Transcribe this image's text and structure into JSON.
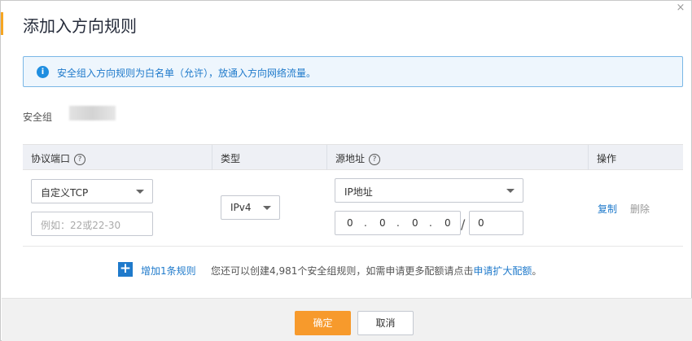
{
  "dialog": {
    "title": "添加入方向规则",
    "close_glyph": "×"
  },
  "notice": {
    "icon": "i",
    "text": "安全组入方向规则为白名单（允许），放通入方向网络流量。"
  },
  "security_group": {
    "label": "安全组"
  },
  "table": {
    "headers": {
      "protocol_port": "协议端口",
      "type": "类型",
      "source": "源地址",
      "actions": "操作"
    },
    "help_glyph": "?",
    "row": {
      "protocol": "自定义TCP",
      "port_placeholder": "例如：22或22-30",
      "ip_type": "IPv4",
      "source_type": "IP地址",
      "ip": [
        "0",
        "0",
        "0",
        "0"
      ],
      "ip_dot": ".",
      "slash": "/",
      "mask": "0",
      "copy": "复制",
      "delete": "删除"
    }
  },
  "add_rule": {
    "icon": "+",
    "link": "增加1条规则",
    "tip": "您还可以创建4,981个安全组规则，如需申请更多配额请点击",
    "tip_link": "申请扩大配额",
    "tip_end": "。"
  },
  "footer": {
    "ok": "确定",
    "cancel": "取消"
  },
  "colors": {
    "accent": "#f79a2c",
    "link": "#1f7acb",
    "info_border": "#7ab7e6"
  }
}
